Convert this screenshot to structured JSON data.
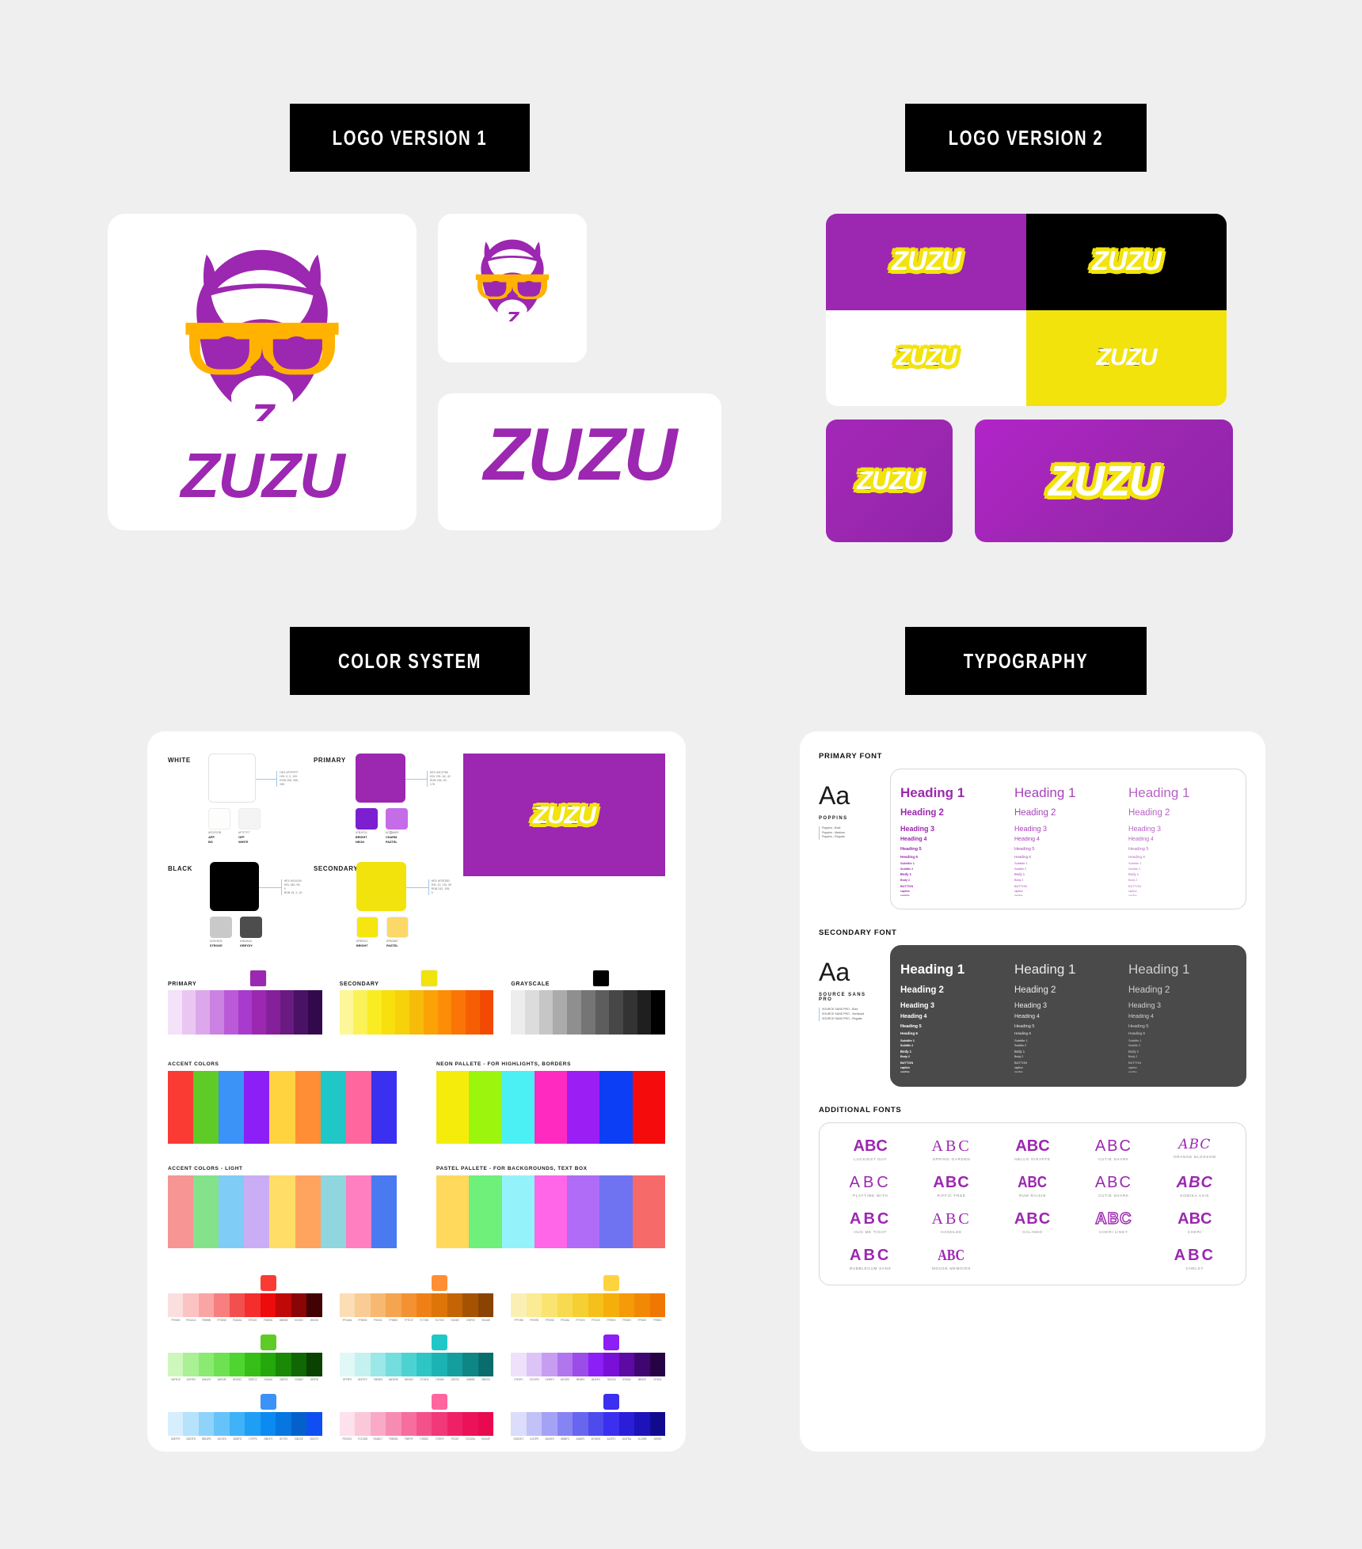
{
  "page": {
    "background": "#efeff0"
  },
  "brand": {
    "name": "ZUZU",
    "primary": "#9c27b0",
    "secondary": "#f2e30d",
    "black": "#000000",
    "white": "#ffffff",
    "accent_orange": "#ffb300"
  },
  "sections": {
    "logo_v1": "LOGO VERSION 1",
    "logo_v2": "LOGO VERSION 2",
    "color_system": "COLOR SYSTEM",
    "typography": "TYPOGRAPHY"
  },
  "logo_v1": {
    "wordmark": "ZUZU",
    "icon_letter": "Z",
    "cards": [
      "logo-lockup-card",
      "icon-only-card",
      "wordmark-card"
    ]
  },
  "logo_v2": {
    "wordmark": "ZUZU",
    "grid_backgrounds": [
      "#9c27b0",
      "#000000",
      "#ffffff",
      "#f2e30d"
    ],
    "tiles": [
      "purple",
      "black",
      "white",
      "yellow"
    ],
    "square_tile_bg": "#9c27b0",
    "rect_tile_bg": "#9c27b0"
  },
  "color_system": {
    "groups": [
      {
        "label": "WHITE",
        "main": "#ffffff",
        "spec": [
          "HEX #FFFFFF",
          "HSL 0, 0, 100",
          "RGB 255, 255, 255"
        ],
        "subs": [
          {
            "hex": "#FDFDFB",
            "name_1": "APP",
            "name_2": "BG",
            "color": "#fdfdfb"
          },
          {
            "hex": "#F7F7F7",
            "name_1": "OFF",
            "name_2": "WHITE",
            "color": "#f4f4f4"
          }
        ]
      },
      {
        "label": "BLACK",
        "main": "#000000",
        "spec": [
          "HEX #010100",
          "HSL 180, 95, 0",
          "RGB 15, 2, 20"
        ],
        "subs": [
          {
            "hex": "#C8C8C8",
            "name_1": "STROKE",
            "name_2": "",
            "color": "#c9c9c9"
          },
          {
            "hex": "#4A4A4A",
            "name_1": "GREYDY",
            "name_2": "",
            "color": "#4d4d4d"
          }
        ]
      },
      {
        "label": "PRIMARY",
        "main": "#9c27b0",
        "spec": [
          "HEX #9C27B0",
          "HSL 291, 64, 42",
          "RGB 156, 39, 176"
        ],
        "subs": [
          {
            "hex": "#7B1FD1",
            "name_1": "BRIGHT",
            "name_2": "NEON",
            "color": "#7b1fd1"
          },
          {
            "hex": "#C濃66EE",
            "name_1": "CHARM",
            "name_2": "PASTEL",
            "color": "#c56ce8"
          }
        ]
      },
      {
        "label": "SECONDARY",
        "main": "#f2e30d",
        "spec": [
          "HEX #F2E30D",
          "HSL 42, 110, 50",
          "RGB 242, 195, 9"
        ],
        "subs": [
          {
            "hex": "#F5E612",
            "name_1": "BRIGHT",
            "name_2": "",
            "color": "#f5e612"
          },
          {
            "hex": "#FBD867",
            "name_1": "PASTEL",
            "name_2": "",
            "color": "#fbd867"
          }
        ]
      }
    ],
    "hero_banner": {
      "background": "#9c27b0",
      "wordmark": "ZUZU"
    },
    "ramps_row1": [
      {
        "label": "PRIMARY",
        "chip": "#9c27b0",
        "colors": [
          "#f3e2f8",
          "#e9c7f2",
          "#dda8eb",
          "#cc82e2",
          "#bb5ad8",
          "#a83bcd",
          "#9c27b0",
          "#85209a",
          "#6a1b80",
          "#4a1264",
          "#33094d"
        ]
      },
      {
        "label": "SECONDARY",
        "chip": "#f2e30d",
        "colors": [
          "#fdf79a",
          "#fbf258",
          "#f9ec22",
          "#f7e00d",
          "#f5d20a",
          "#f7bb09",
          "#fba207",
          "#fd8c06",
          "#fa7505",
          "#f65e04",
          "#f24a02"
        ]
      },
      {
        "label": "GRAYSCALE",
        "chip": "#000000",
        "colors": [
          "#ededed",
          "#dcdcdc",
          "#c6c6c6",
          "#ababab",
          "#8f8f8f",
          "#757575",
          "#5d5d5d",
          "#474747",
          "#333333",
          "#1f1f1f",
          "#000000"
        ]
      }
    ],
    "accent_colors": {
      "label": "ACCENT COLORS",
      "colors": [
        "#f93b34",
        "#5fcb27",
        "#3b92f7",
        "#8c1ff5",
        "#ffd23f",
        "#ff8e34",
        "#1fc7c7",
        "#ff669d",
        "#3b2ff0"
      ]
    },
    "neon_pallete": {
      "label": "NEON PALLETE - FOR HIGHLIGHTS, BORDERS",
      "colors": [
        "#f5ec0c",
        "#9cf50c",
        "#4bf0f5",
        "#ff2bc1",
        "#9b1ff5",
        "#0b3ef5",
        "#f50b0b"
      ]
    },
    "accent_colors_light": {
      "label": "ACCENT COLORS - LIGHT",
      "colors": [
        "#f79494",
        "#84e38a",
        "#7fcdf7",
        "#c9aef5",
        "#ffdd66",
        "#ffa45f",
        "#8fd6de",
        "#ff7fc0",
        "#4a7af2"
      ]
    },
    "pastel_pallete": {
      "label": "PASTEL PALLETE - FOR BACKGROUNDS, TEXT BOX",
      "colors": [
        "#ffd95c",
        "#6ef07b",
        "#94f2fb",
        "#ff66e8",
        "#b06bf7",
        "#6f73f2",
        "#f76a6a"
      ]
    },
    "tonal_ramps": [
      {
        "chip": "#f93b34",
        "colors": [
          "#fbdede",
          "#fcc3c3",
          "#faa5a5",
          "#f87f7f",
          "#f44f4f",
          "#f52d2d",
          "#ee0b0b",
          "#c00808",
          "#8a0505",
          "#400202"
        ],
        "hexes": [
          "FFE6E6",
          "FECACA",
          "FB9B9B",
          "FF5D5D",
          "FA3A3A",
          "EF2020",
          "F50B0B",
          "B80808",
          "5C0202",
          "2B0000"
        ]
      },
      {
        "chip": "#ff8e34",
        "colors": [
          "#fbddb6",
          "#f9cc94",
          "#f7b972",
          "#f5a44f",
          "#f39133",
          "#ee8017",
          "#dd7509",
          "#c56405",
          "#a55203",
          "#8a4302"
        ],
        "hexes": [
          "FFDAA6",
          "FFBE80",
          "FFA04C",
          "FF8B1E",
          "FF7E1F",
          "FC7306",
          "EC7000",
          "E46400",
          "C05F00",
          "9D4A00"
        ]
      },
      {
        "chip": "#ffd23f",
        "colors": [
          "#fbf0b4",
          "#faeb94",
          "#f9e471",
          "#f7da4f",
          "#f5cf33",
          "#f5c01b",
          "#f6ae0c",
          "#f59a08",
          "#f28905",
          "#f07702"
        ],
        "hexes": [
          "FFF2B8",
          "FFE87B",
          "FFE055",
          "FFD43A",
          "FFC920",
          "FFC100",
          "FFB900",
          "FFA500",
          "FF9600",
          "FF8600"
        ]
      },
      {
        "chip": "#5fcb27",
        "colors": [
          "#cdf7bd",
          "#aaf094",
          "#8aea72",
          "#6de152",
          "#4fd52f",
          "#36c017",
          "#24a80c",
          "#198906",
          "#106703",
          "#094201"
        ],
        "hexes": [
          "D6F9C8",
          "ADF290",
          "8AEA70",
          "6AE04E",
          "4ED52C",
          "32BC12",
          "1FA40A",
          "158703",
          "0C6602",
          "053F00"
        ]
      },
      {
        "chip": "#1fc7c7",
        "colors": [
          "#e0f8f8",
          "#c5f1f1",
          "#9ce7e7",
          "#74dddd",
          "#4dd2d2",
          "#2ec5c5",
          "#1bb3b3",
          "#149e9e",
          "#0e8686",
          "#0a6d6d"
        ],
        "hexes": [
          "DFF9F9",
          "BDF2F2",
          "93E8E8",
          "6ADEDE",
          "46D3D3",
          "27C6C6",
          "17B4B4",
          "109C9C",
          "0A8585",
          "056C6C"
        ]
      },
      {
        "chip": "#8c1ff5",
        "colors": [
          "#efe1fb",
          "#ddc4f7",
          "#c79df2",
          "#b175ed",
          "#9c4ce8",
          "#8c1ff5",
          "#7a0fd8",
          "#5c0aa3",
          "#3f0672",
          "#260444"
        ],
        "hexes": [
          "F0E3FC",
          "DCC6F8",
          "C49BF3",
          "AE72EE",
          "9849E9",
          "8A1DF4",
          "760CD6",
          "5709A0",
          "3B0670",
          "210341"
        ]
      },
      {
        "chip": "#3b92f7",
        "colors": [
          "#d7eefd",
          "#b6e2fc",
          "#8fd3fb",
          "#66c3f9",
          "#3fb2f8",
          "#1f9ef6",
          "#0b8bf2",
          "#0676e0",
          "#0461cc",
          "#0f4ef0"
        ],
        "hexes": [
          "D8EFFE",
          "B4E3FD",
          "8BD4FB",
          "60C4FA",
          "36B2F8",
          "179FF6",
          "058CF3",
          "0077E2",
          "0062CE",
          "0B4CF1"
        ]
      },
      {
        "chip": "#ff669d",
        "colors": [
          "#fde1ec",
          "#fbc8da",
          "#f9aac6",
          "#f78cb2",
          "#f56e9e",
          "#f4518b",
          "#f13878",
          "#ef2166",
          "#ec1259",
          "#e8094e"
        ],
        "hexes": [
          "FEE2ED",
          "FCC9DB",
          "FAABC7",
          "F88DB3",
          "F66F9F",
          "F4528C",
          "F23979",
          "F02267",
          "ED135A",
          "EA0A4F"
        ]
      },
      {
        "chip": "#3b2ff0",
        "colors": [
          "#dcdcfb",
          "#c2c1f8",
          "#a4a2f5",
          "#8684f2",
          "#6866ef",
          "#4d4bec",
          "#3b2ff0",
          "#2a1ed9",
          "#1d13b8",
          "#110a8f"
        ],
        "hexes": [
          "DDDDFC",
          "C4C3F9",
          "A6A4F6",
          "8886F3",
          "6A68F0",
          "4F4DED",
          "3A2EF1",
          "2A1FDA",
          "1C12B9",
          "100990"
        ]
      }
    ]
  },
  "typography": {
    "primary_font": {
      "section_label": "PRIMARY FONT",
      "sample": "Aa",
      "family": "POPPINS",
      "weights": [
        "Poppins - Bold",
        "Poppins - Medium",
        "Poppins - Regular"
      ],
      "scale": [
        "Heading 1",
        "Heading 2",
        "Heading 3",
        "Heading 4",
        "Heading 5",
        "Heading 6",
        "Subtitle 1",
        "Subtitle 2",
        "Body 1",
        "Body 2",
        "BUTTON",
        "caption",
        "overline"
      ]
    },
    "secondary_font": {
      "section_label": "SECONDARY FONT",
      "sample": "Aa",
      "family": "SOURCE SANS PRO",
      "weights": [
        "SOURCE SANS PRO - Bold",
        "SOURCE SANS PRO - Semibold",
        "SOURCE SANS PRO - Regular"
      ],
      "scale": [
        "Heading 1",
        "Heading 2",
        "Heading 3",
        "Heading 4",
        "Heading 5",
        "Heading 6",
        "Subtitle 1",
        "Subtitle 2",
        "Body 1",
        "Body 2",
        "BUTTON",
        "caption",
        "overline"
      ]
    },
    "additional_fonts": {
      "section_label": "ADDITIONAL FONTS",
      "specimen": "ABC",
      "items": [
        {
          "name": "LUCKIEST GUY",
          "style": "heavy"
        },
        {
          "name": "SPRING GARDEN",
          "style": "thin"
        },
        {
          "name": "HELLO GIRAFFE",
          "style": "bold-round"
        },
        {
          "name": "CUTIE SHARK",
          "style": "light-round"
        },
        {
          "name": "ORANGE BLOSSOM",
          "style": "script"
        },
        {
          "name": "PLAYTIME WITH",
          "style": "light-wide"
        },
        {
          "name": "RIFFIC FREE",
          "style": "heavy-round"
        },
        {
          "name": "RUM RAISIN",
          "style": "condensed-bold"
        },
        {
          "name": "CUTIE SHARK",
          "style": "light-round"
        },
        {
          "name": "KOMIKA AXIS",
          "style": "italic-bold"
        },
        {
          "name": "HUG ME TIGHT",
          "style": "bold"
        },
        {
          "name": "HANDLEE",
          "style": "thin"
        },
        {
          "name": "GALINDO",
          "style": "heavy-round"
        },
        {
          "name": "CHERI LINEY",
          "style": "outline"
        },
        {
          "name": "CHERI",
          "style": "bold-round"
        },
        {
          "name": "BUBBLEGUM SANS",
          "style": "bold"
        },
        {
          "name": "MOUSE MEMOIRS",
          "style": "condensed"
        },
        {
          "name": "",
          "style": "empty"
        },
        {
          "name": "",
          "style": "empty"
        },
        {
          "name": "CHELSY",
          "style": "bold"
        }
      ]
    }
  }
}
